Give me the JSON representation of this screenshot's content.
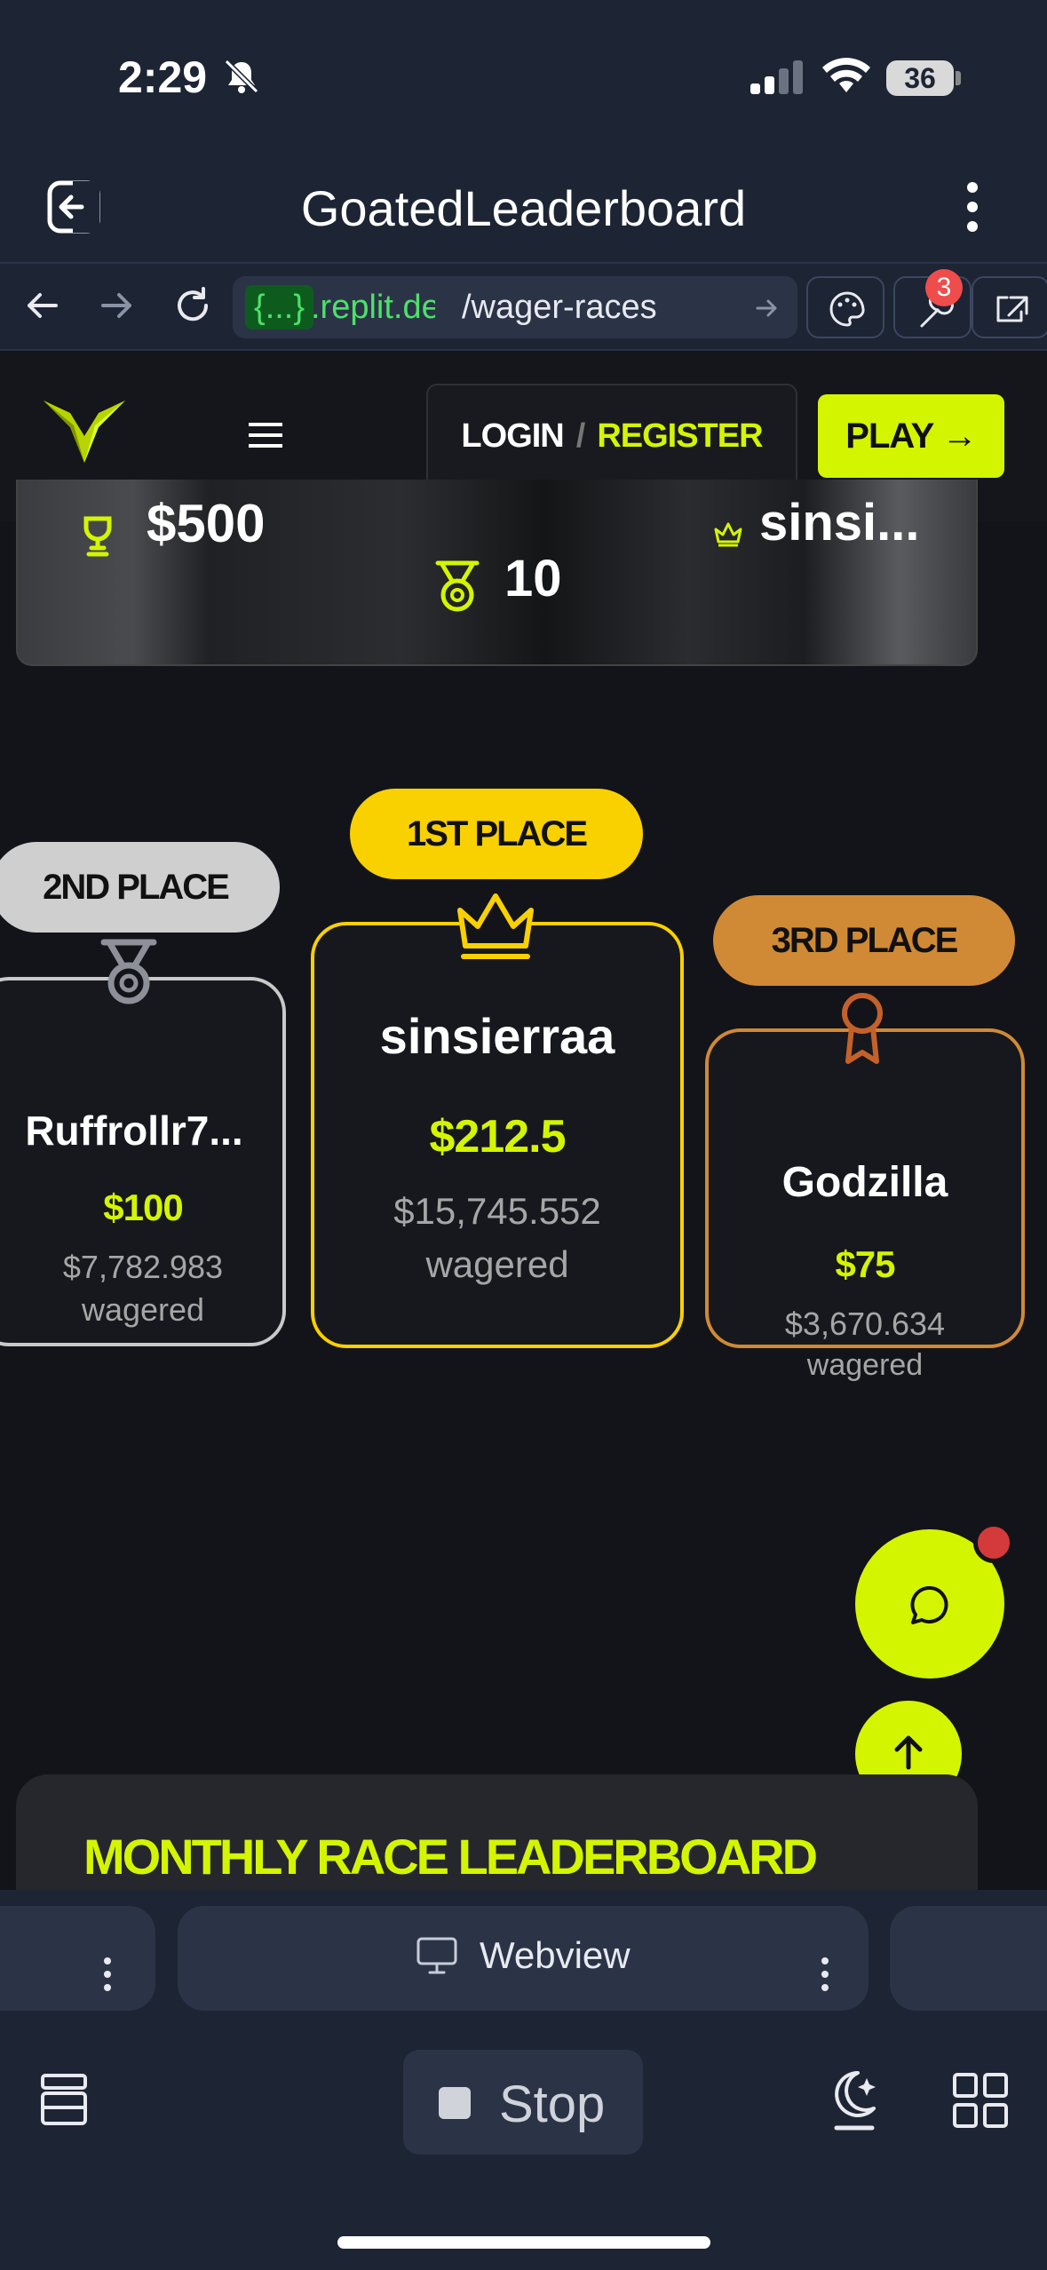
{
  "status_bar": {
    "time": "2:29",
    "battery": "36"
  },
  "app_header": {
    "title": "GoatedLeaderboard"
  },
  "url_bar": {
    "domain_box": "{...}",
    "domain_rest": ".replit.dev",
    "path": "/wager-races",
    "notification_count": "3"
  },
  "site_nav": {
    "login_label": "LOGIN",
    "slash": "/",
    "register_label": "REGISTER",
    "play_label": "PLAY →"
  },
  "summary": {
    "prize_pool": "$500",
    "winners": "10",
    "leader": "sinsi..."
  },
  "podium": {
    "second": {
      "place": "2ND PLACE",
      "name": "Ruffrollr7...",
      "prize": "$100",
      "wagered": "$7,782.983",
      "wagered_label": "wagered"
    },
    "first": {
      "place": "1ST PLACE",
      "name": "sinsierraa",
      "prize": "$212.5",
      "wagered": "$15,745.552",
      "wagered_label": "wagered"
    },
    "third": {
      "place": "3RD PLACE",
      "name": "Godzilla",
      "prize": "$75",
      "wagered": "$3,670.634",
      "wagered_label": "wagered"
    }
  },
  "monthly": {
    "title": "MONTHLY RACE LEADERBOARD"
  },
  "bottom_bar": {
    "webview_label": "Webview",
    "stop_label": "Stop"
  },
  "colors": {
    "accent": "#d4f500",
    "gold": "#f9d000",
    "silver": "#c9c9c9",
    "bronze": "#d08a35",
    "chrome_bg": "#1d2434"
  }
}
